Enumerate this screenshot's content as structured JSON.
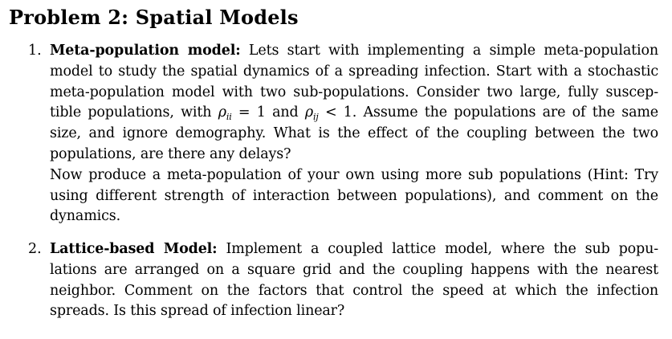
{
  "heading": {
    "label": "Problem 2:",
    "title": "Spatial Models"
  },
  "items": [
    {
      "number": "1.",
      "lines": [
        {
          "term": "Meta-population model:",
          "text": " Lets start with implementing a simple meta-population"
        },
        {
          "text": "model to study the spatial dynamics of a spreading infection. Start with a stochastic"
        },
        {
          "text": "meta-population model with two sub-populations. Consider two large, fully suscep-"
        },
        {
          "text_before": "tible populations, with ",
          "math1_symbol": "ρ",
          "math1_sub": "ii",
          "math1_op": " = 1 and ",
          "math2_symbol": "ρ",
          "math2_sub": "ij",
          "math2_op": " < 1",
          "text_after": ". Assume the populations are of the same"
        },
        {
          "text": "size, and ignore demography. What is the effect of the coupling between the two"
        },
        {
          "text": "populations, are there any delays?"
        },
        {
          "text": "Now produce a meta-population of your own using more sub populations (Hint: Try"
        },
        {
          "text": "using different strength of interaction between populations), and comment on the"
        },
        {
          "text": "dynamics."
        }
      ]
    },
    {
      "number": "2.",
      "lines": [
        {
          "term": "Lattice-based Model:",
          "text": " Implement a coupled lattice model, where the sub popu-"
        },
        {
          "text": "lations are arranged on a square grid and the coupling happens with the nearest"
        },
        {
          "text": "neighbor. Comment on the factors that control the speed at which the infection"
        },
        {
          "text": "spreads. Is this spread of infection linear?"
        }
      ]
    }
  ]
}
